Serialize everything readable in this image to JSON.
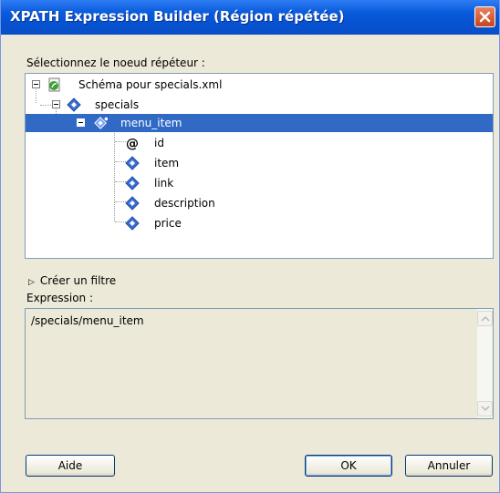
{
  "window": {
    "title": "XPATH Expression Builder (Région répétée)"
  },
  "tree": {
    "label": "Sélectionnez le noeud répéteur :",
    "nodes": [
      {
        "label": "Schéma pour specials.xml",
        "icon": "schema-icon"
      },
      {
        "label": "specials",
        "icon": "element-icon"
      },
      {
        "label": "menu_item",
        "icon": "repeating-element-icon",
        "selected": true
      },
      {
        "label": "id",
        "icon": "attribute-icon"
      },
      {
        "label": "item",
        "icon": "element-icon"
      },
      {
        "label": "link",
        "icon": "element-icon"
      },
      {
        "label": "description",
        "icon": "element-icon"
      },
      {
        "label": "price",
        "icon": "element-icon"
      }
    ]
  },
  "filter": {
    "label": "Créer un filtre"
  },
  "expression": {
    "label": "Expression :",
    "value": "/specials/menu_item"
  },
  "buttons": {
    "help": "Aide",
    "ok": "OK",
    "cancel": "Annuler"
  },
  "colors": {
    "titlebar": "#0a5cdc",
    "selection": "#316ac5",
    "close": "#c9431b"
  }
}
